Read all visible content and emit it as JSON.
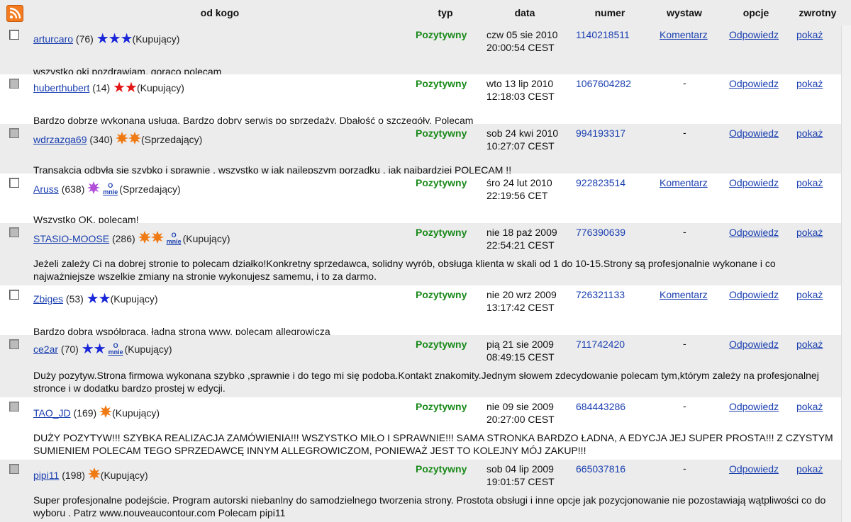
{
  "header": {
    "rss_icon": "rss-feed-icon",
    "cols": [
      "od kogo",
      "typ",
      "data",
      "numer",
      "wystaw",
      "opcje",
      "zwrotny"
    ]
  },
  "rows": [
    {
      "user": "arturcaro",
      "count": "(76)",
      "badge": {
        "kind": "star-blue",
        "n": 3
      },
      "omnie": false,
      "role": "(Kupujący)",
      "typ": "Pozytywny",
      "date1": "czw 05 sie 2010",
      "date2": "20:00:54 CEST",
      "numer": "1140218511",
      "wystaw": "Komentarz",
      "opcje": "Odpowiedz",
      "zwrotny": "pokaż",
      "comment": "wszystko oki pozdrawiam, goraco polecam",
      "checked": false
    },
    {
      "user": "huberthubert",
      "count": "(14)",
      "badge": {
        "kind": "star-red",
        "n": 2
      },
      "omnie": false,
      "role": "(Kupujący)",
      "typ": "Pozytywny",
      "date1": "wto 13 lip 2010",
      "date2": "12:18:03 CEST",
      "numer": "1067604282",
      "wystaw": "-",
      "opcje": "Odpowiedz",
      "zwrotny": "pokaż",
      "comment": "Bardzo dobrze wykonana usługa. Bardzo dobry serwis po sprzedaży. Dbałość o szczegóły. Polecam",
      "checked": true
    },
    {
      "user": "wdrzazga69",
      "count": "(340)",
      "badge": {
        "kind": "sun-orange",
        "n": 2
      },
      "omnie": false,
      "role": "(Sprzedający)",
      "typ": "Pozytywny",
      "date1": "sob 24 kwi 2010",
      "date2": "10:27:07 CEST",
      "numer": "994193317",
      "wystaw": "-",
      "opcje": "Odpowiedz",
      "zwrotny": "pokaż",
      "comment": "Transakcja odbyła się szybko i sprawnie , wszystko w jak najlepszym porządku , jak najbardziej POLECAM !!",
      "checked": true
    },
    {
      "user": "Aruss",
      "count": "(638)",
      "badge": {
        "kind": "sun-purple",
        "n": 1
      },
      "omnie": true,
      "role": "(Sprzedający)",
      "typ": "Pozytywny",
      "date1": "śro 24 lut 2010",
      "date2": "22:19:56 CET",
      "numer": "922823514",
      "wystaw": "Komentarz",
      "opcje": "Odpowiedz",
      "zwrotny": "pokaż",
      "comment": "Wszystko OK, polecam!",
      "checked": false
    },
    {
      "user": "STASIO-MOOSE",
      "count": "(286)",
      "badge": {
        "kind": "sun-orange",
        "n": 2
      },
      "omnie": true,
      "role": "(Kupujący)",
      "typ": "Pozytywny",
      "date1": "nie 18 paź 2009",
      "date2": "22:54:21 CEST",
      "numer": "776390639",
      "wystaw": "-",
      "opcje": "Odpowiedz",
      "zwrotny": "pokaż",
      "comment": "Jeżeli zależy Ci na dobrej stronie to polecam działko!Konkretny sprzedawca, solidny wyrób, obsługa klienta w skali od 1 do 10-15.Strony są profesjonalnie wykonane i co najważniejsze wszelkie zmiany na stronie wykonujesz samemu, i to za darmo.",
      "checked": true
    },
    {
      "user": "Zbiges",
      "count": "(53)",
      "badge": {
        "kind": "star-blue",
        "n": 2
      },
      "omnie": false,
      "role": "(Kupujący)",
      "typ": "Pozytywny",
      "date1": "nie 20 wrz 2009",
      "date2": "13:17:42 CEST",
      "numer": "726321133",
      "wystaw": "Komentarz",
      "opcje": "Odpowiedz",
      "zwrotny": "pokaż",
      "comment": "Bardzo dobra współpraca, ładna strona www, polecam allegrowicza",
      "checked": false
    },
    {
      "user": "ce2ar",
      "count": "(70)",
      "badge": {
        "kind": "star-blue",
        "n": 2
      },
      "omnie": true,
      "role": "(Kupujący)",
      "typ": "Pozytywny",
      "date1": "pią 21 sie 2009",
      "date2": "08:49:15 CEST",
      "numer": "711742420",
      "wystaw": "-",
      "opcje": "Odpowiedz",
      "zwrotny": "pokaż",
      "comment": "Duży pozytyw.Strona firmowa wykonana szybko ,sprawnie i do tego mi się podoba.Kontakt znakomity.Jednym słowem zdecydowanie polecam tym,którym zależy na profesjonalnej stronce i w dodatku bardzo prostej w edycji.",
      "checked": true
    },
    {
      "user": "TAO_JD",
      "count": "(169)",
      "badge": {
        "kind": "sun-orange",
        "n": 1
      },
      "omnie": false,
      "role": "(Kupujący)",
      "typ": "Pozytywny",
      "date1": "nie 09 sie 2009",
      "date2": "20:27:00 CEST",
      "numer": "684443286",
      "wystaw": "-",
      "opcje": "Odpowiedz",
      "zwrotny": "pokaż",
      "comment": "DUŻY POZYTYW!!! SZYBKA REALIZACJA ZAMÓWIENIA!!! WSZYSTKO MIŁO I SPRAWNIE!!! SAMA STRONKA BARDZO ŁADNA, A EDYCJA JEJ SUPER PROSTA!!! Z CZYSTYM SUMIENIEM POLECAM TEGO SPRZEDAWCĘ INNYM ALLEGROWICZOM, PONIEWAŻ JEST TO KOLEJNY MÓJ ZAKUP!!!",
      "checked": true
    },
    {
      "user": "pipi11",
      "count": "(198)",
      "badge": {
        "kind": "sun-orange",
        "n": 1
      },
      "omnie": false,
      "role": "(Kupujący)",
      "typ": "Pozytywny",
      "date1": "sob 04 lip 2009",
      "date2": "19:01:57 CEST",
      "numer": "665037816",
      "wystaw": "-",
      "opcje": "Odpowiedz",
      "zwrotny": "pokaż",
      "comment": "Super profesjonalne podejście. Program autorski niebanlny do samodzielnego tworzenia strony. Prostota obsługi i inne opcje jak pozycjonowanie nie pozostawiają wątpliwości co do wyboru . Patrz www.nouveaucontour.com Polecam pipi11",
      "checked": true
    }
  ],
  "omnie_label": {
    "top": "O",
    "bottom": "mnie"
  },
  "colors": {
    "positive": "#1a8a1a",
    "link": "#1a3fb0",
    "alt_row": "#ececec"
  }
}
